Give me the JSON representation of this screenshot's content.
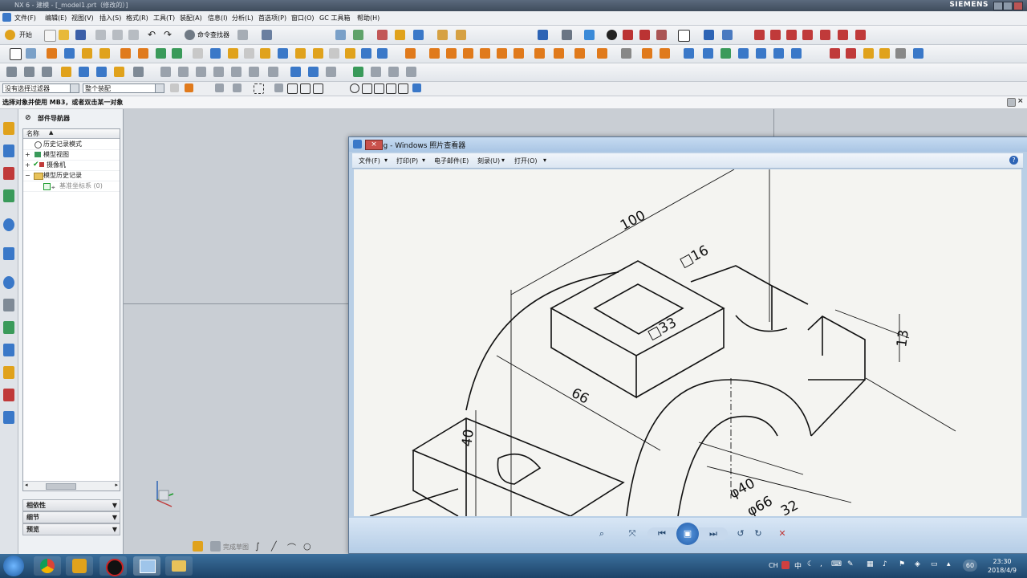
{
  "window": {
    "title": "NX 6 - 建模 - [_model1.prt（修改的）]",
    "brand": "SIEMENS"
  },
  "menu": [
    "文件(F)",
    "编辑(E)",
    "视图(V)",
    "插入(S)",
    "格式(R)",
    "工具(T)",
    "装配(A)",
    "信息(I)",
    "分析(L)",
    "首选项(P)",
    "窗口(O)",
    "GC 工具箱",
    "帮助(H)"
  ],
  "toolbar": {
    "start_label": "开始",
    "command_finder_label": "命令查找器"
  },
  "selection_bar": {
    "filter_value": "没有选择过滤器",
    "scope_value": "整个装配"
  },
  "cue_line": "选择对象并使用 MB3，或者双击某一对象",
  "navigator": {
    "title": "部件导航器",
    "column_name": "名称",
    "items": [
      {
        "label": "历史记录模式",
        "level": 0
      },
      {
        "label": "模型视图",
        "level": 0
      },
      {
        "label": "摄像机",
        "level": 0
      },
      {
        "label": "模型历史记录",
        "level": 0
      },
      {
        "label": "基准坐标系 (0)",
        "level": 1
      }
    ],
    "sections": [
      "相依性",
      "细节",
      "预览"
    ]
  },
  "viewer": {
    "title": "51.jpg - Windows 照片查看器",
    "menu": [
      "文件(F)",
      "打印(P)",
      "电子邮件(E)",
      "刻录(U)",
      "打开(O)"
    ],
    "drawing_labels": {
      "dim_100": "100",
      "dim_16": "□16",
      "dim_33": "□33",
      "dim_13": "13",
      "dim_66": "66",
      "dim_40": "40",
      "dim_phi40": "φ40",
      "dim_phi66": "φ66",
      "dim_partial": "32"
    }
  },
  "status_bar": {
    "label": "完成草图"
  },
  "taskbar": {
    "time": "23:30",
    "date": "2018/4/9",
    "tray_number": "60",
    "ime_label": "CH"
  },
  "colors": {
    "title_bar": "#4a5869",
    "toolbar_bg": "#e9ecef",
    "graphics_bg": "#c9ced4",
    "viewer_frame": "#b9cfe6",
    "taskbar": "#2b5a86"
  }
}
